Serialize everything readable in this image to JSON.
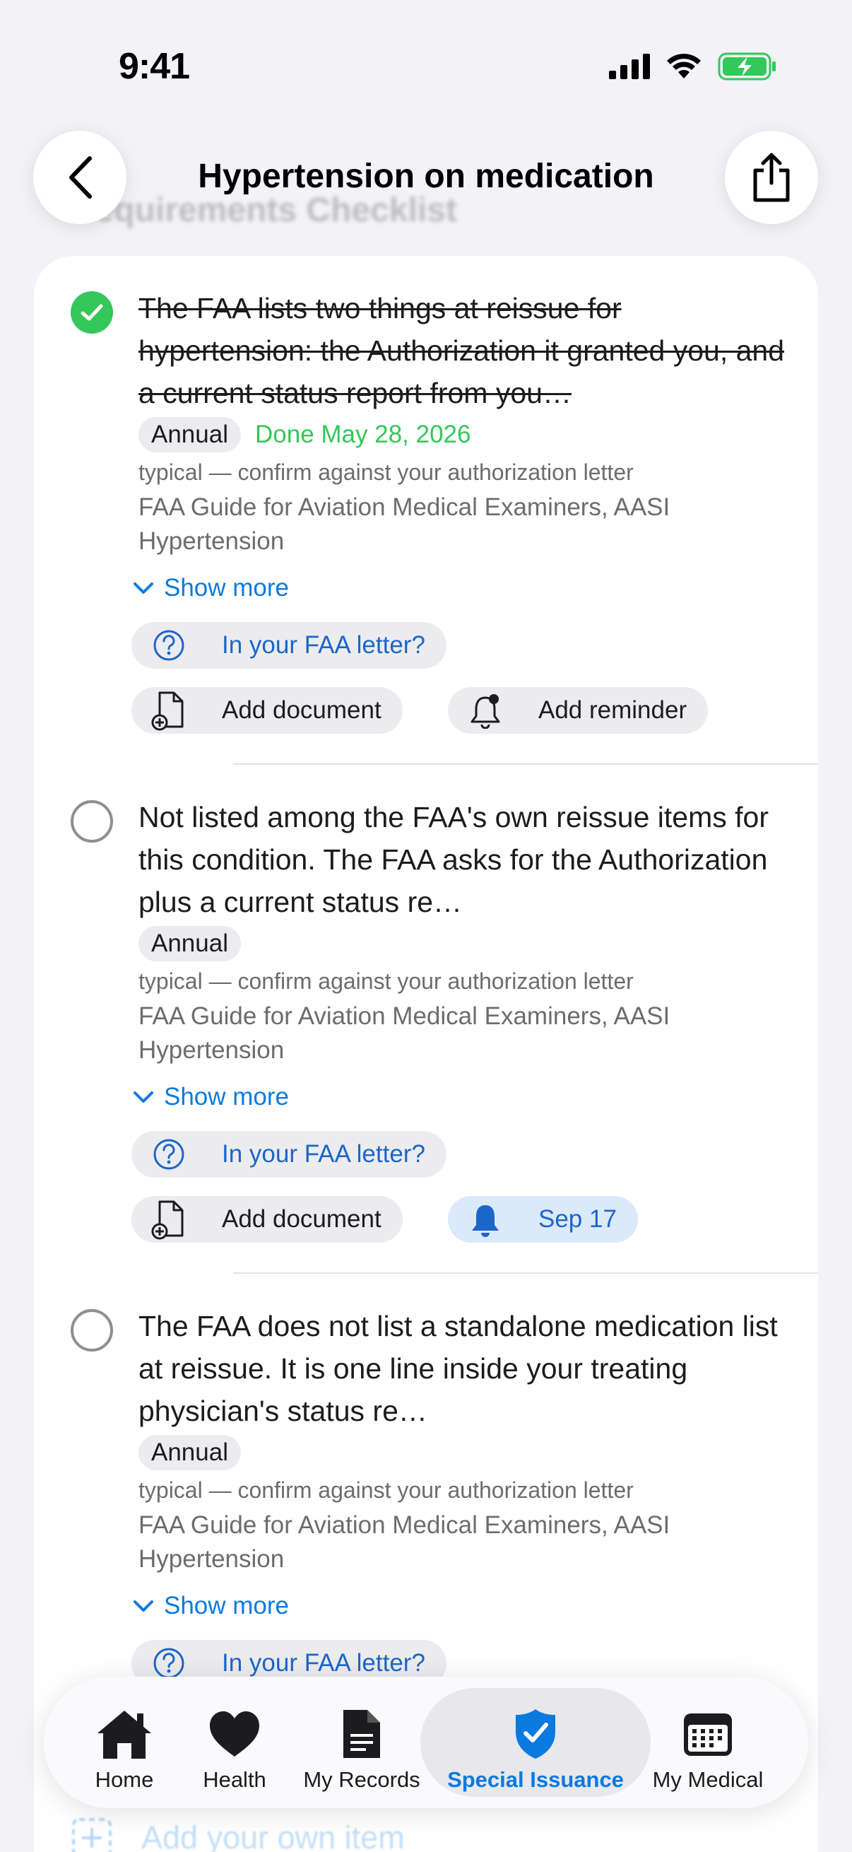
{
  "status_bar": {
    "time": "9:41"
  },
  "header": {
    "title": "Hypertension on medication",
    "ghost_section_title": "Requirements Checklist"
  },
  "items": [
    {
      "checked": true,
      "title": "The FAA lists two things at reissue for hypertension: the Authorization it granted you, and a current status report from you…",
      "badge": "Annual",
      "done_text": "Done May 28, 2026",
      "typical": "typical — confirm against your authorization letter",
      "source": "FAA Guide for Aviation Medical Examiners, AASI Hypertension",
      "show_more": "Show more",
      "letter_question": "In your FAA letter?",
      "add_document": "Add document",
      "reminder": "Add reminder"
    },
    {
      "checked": false,
      "title": "Not listed among the FAA's own reissue items for this condition. The FAA asks for the Authorization plus a current status re…",
      "badge": "Annual",
      "typical": "typical — confirm against your authorization letter",
      "source": "FAA Guide for Aviation Medical Examiners, AASI Hypertension",
      "show_more": "Show more",
      "letter_question": "In your FAA letter?",
      "add_document": "Add document",
      "reminder": "Sep 17"
    },
    {
      "checked": false,
      "title": "The FAA does not list a standalone medication list at reissue. It is one line inside your treating physician's status re…",
      "badge": "Annual",
      "typical": "typical — confirm against your authorization letter",
      "source": "FAA Guide for Aviation Medical Examiners, AASI Hypertension",
      "show_more": "Show more",
      "letter_question": "In your FAA letter?"
    }
  ],
  "ghost_add_item": "Add your own item",
  "tabs": [
    {
      "label": "Home",
      "icon": "house-icon",
      "active": false
    },
    {
      "label": "Health",
      "icon": "heart-icon",
      "active": false
    },
    {
      "label": "My Records",
      "icon": "document-icon",
      "active": false
    },
    {
      "label": "Special Issuance",
      "icon": "shield-check-icon",
      "active": true
    },
    {
      "label": "My Medical",
      "icon": "calendar-icon",
      "active": false
    }
  ],
  "colors": {
    "accent": "#0a7ae0",
    "done_green": "#34c759",
    "reminder_bg": "#dbe9fb"
  }
}
